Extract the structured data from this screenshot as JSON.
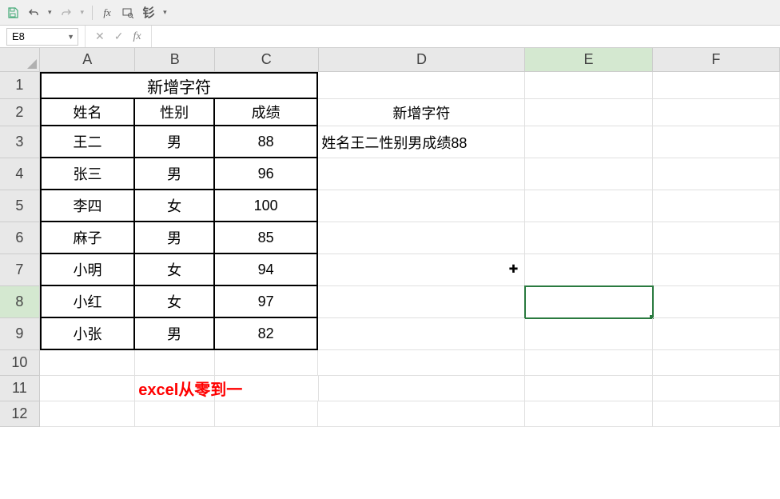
{
  "toolbar": {
    "save": "save-icon",
    "undo": "undo-icon",
    "redo": "redo-icon"
  },
  "name_box": {
    "value": "E8"
  },
  "formula_bar": {
    "fx_label": "fx",
    "value": ""
  },
  "columns": [
    "A",
    "B",
    "C",
    "D",
    "E",
    "F"
  ],
  "rows": [
    "1",
    "2",
    "3",
    "4",
    "5",
    "6",
    "7",
    "8",
    "9",
    "10",
    "11",
    "12"
  ],
  "selected_cell": "E8",
  "data": {
    "title_merged": "新增字符",
    "headers": {
      "a": "姓名",
      "b": "性别",
      "c": "成绩"
    },
    "d2": "新增字符",
    "d3": "姓名王二性别男成绩88",
    "table": [
      {
        "name": "王二",
        "gender": "男",
        "score": "88"
      },
      {
        "name": "张三",
        "gender": "男",
        "score": "96"
      },
      {
        "name": "李四",
        "gender": "女",
        "score": "100"
      },
      {
        "name": "麻子",
        "gender": "男",
        "score": "85"
      },
      {
        "name": "小明",
        "gender": "女",
        "score": "94"
      },
      {
        "name": "小红",
        "gender": "女",
        "score": "97"
      },
      {
        "name": "小张",
        "gender": "男",
        "score": "82"
      }
    ],
    "note": "excel从零到一"
  }
}
